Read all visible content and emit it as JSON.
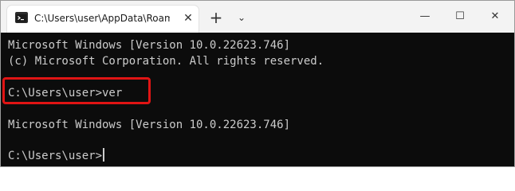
{
  "window": {
    "tab_title": "C:\\Users\\user\\AppData\\Roam",
    "tab_icon": "terminal-icon",
    "tab_close": "✕",
    "new_tab": "+",
    "dropdown": "⌄",
    "minimize": "—",
    "maximize": "☐",
    "close": "✕"
  },
  "terminal": {
    "lines": [
      "Microsoft Windows [Version 10.0.22623.746]",
      "(c) Microsoft Corporation. All rights reserved.",
      "C:\\Users\\user>ver",
      "Microsoft Windows [Version 10.0.22623.746]",
      "C:\\Users\\user>"
    ],
    "text_color": "#cccccc",
    "background": "#0c0c0c",
    "highlight_color": "#e01414"
  }
}
